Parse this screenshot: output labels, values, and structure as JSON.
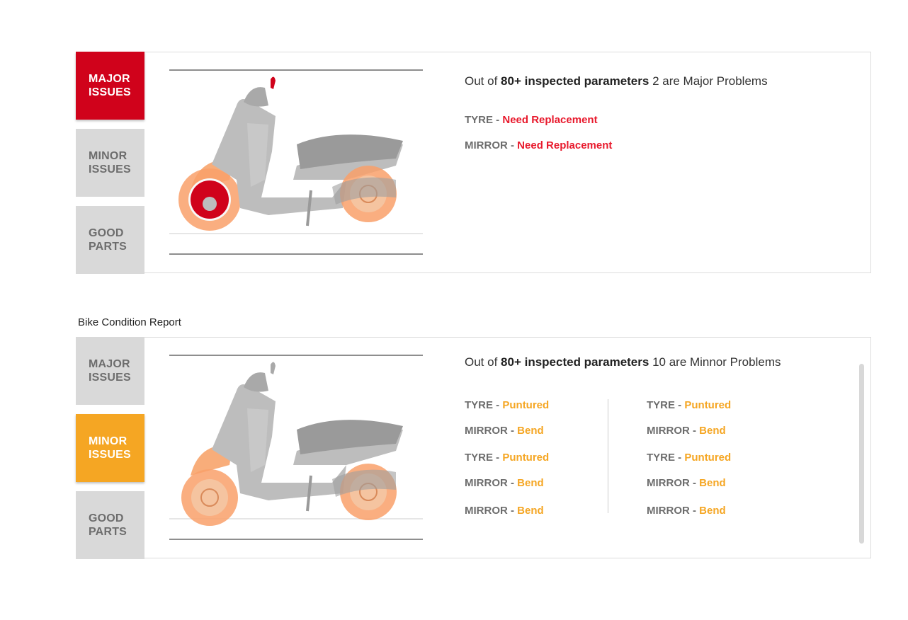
{
  "major_panel": {
    "tabs": [
      {
        "label": "MAJOR\nISSUES",
        "active": true
      },
      {
        "label": "MINOR\nISSUES",
        "active": false
      },
      {
        "label": "GOOD\nPARTS",
        "active": false
      }
    ],
    "headline": {
      "prefix": "Out of ",
      "bold": "80+ inspected parameters",
      "suffix": " 2 are Major Problems"
    },
    "issues": [
      {
        "part": "TYRE",
        "status": "Need Replacement"
      },
      {
        "part": "MIRROR",
        "status": "Need Replacement"
      }
    ],
    "accent": "#d0021b"
  },
  "section_title": "Bike Condition Report",
  "minor_panel": {
    "tabs": [
      {
        "label": "MAJOR\nISSUES",
        "active": false
      },
      {
        "label": "MINOR\nISSUES",
        "active": true
      },
      {
        "label": "GOOD\nPARTS",
        "active": false
      }
    ],
    "headline": {
      "prefix": "Out of ",
      "bold": "80+ inspected parameters",
      "suffix": " 10 are Minnor Problems"
    },
    "issues_left": [
      {
        "part": "TYRE",
        "status": "Puntured"
      },
      {
        "part": "MIRROR",
        "status": "Bend"
      },
      {
        "part": "TYRE",
        "status": "Puntured"
      },
      {
        "part": "MIRROR",
        "status": "Bend"
      },
      {
        "part": "MIRROR",
        "status": "Bend"
      }
    ],
    "issues_right": [
      {
        "part": "TYRE",
        "status": "Puntured"
      },
      {
        "part": "MIRROR",
        "status": "Bend"
      },
      {
        "part": "TYRE",
        "status": "Puntured"
      },
      {
        "part": "MIRROR",
        "status": "Bend"
      },
      {
        "part": "MIRROR",
        "status": "Bend"
      }
    ],
    "accent": "#f5a623"
  },
  "separator": " - "
}
